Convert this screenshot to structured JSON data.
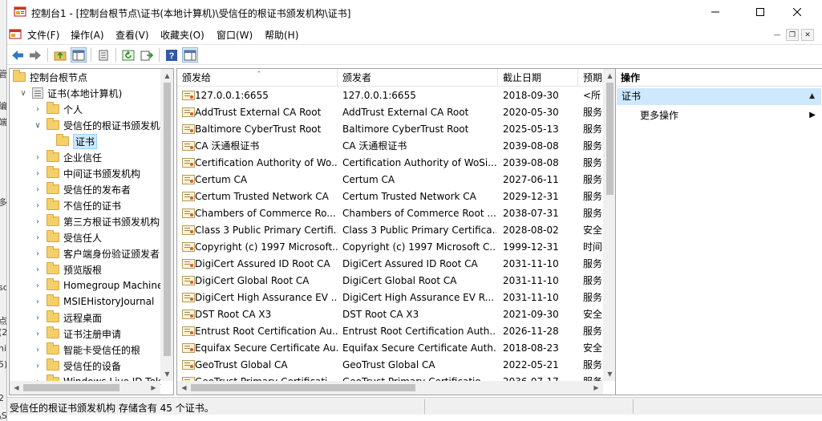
{
  "background_fragments": [
    "管",
    "编",
    "端",
    "多",
    "sc",
    "点",
    "(2",
    "ni",
    "5)",
    "2",
    "\\S"
  ],
  "window": {
    "title": "控制台1 - [控制台根节点\\证书(本地计算机)\\受信任的根证书颁发机构\\证书]"
  },
  "menu": [
    "文件(F)",
    "操作(A)",
    "查看(V)",
    "收藏夹(O)",
    "窗口(W)",
    "帮助(H)"
  ],
  "toolbar_icons": [
    "back-icon",
    "forward-icon",
    "up-folder-icon",
    "show-hide-tree-icon",
    "copy-icon",
    "refresh-icon",
    "export-list-icon",
    "help-icon",
    "show-hide-action-pane-icon"
  ],
  "tree": {
    "root": "控制台根节点",
    "store": "证书(本地计算机)",
    "items": [
      {
        "label": "个人",
        "expanded": false
      },
      {
        "label": "受信任的根证书颁发机构",
        "expanded": true
      },
      {
        "label": "证书",
        "child": true,
        "selected": true
      },
      {
        "label": "企业信任",
        "expanded": false
      },
      {
        "label": "中间证书颁发机构",
        "expanded": false
      },
      {
        "label": "受信任的发布者",
        "expanded": false
      },
      {
        "label": "不信任的证书",
        "expanded": false
      },
      {
        "label": "第三方根证书颁发机构",
        "expanded": false
      },
      {
        "label": "受信任人",
        "expanded": false
      },
      {
        "label": "客户端身份验证颁发者",
        "expanded": false
      },
      {
        "label": "预览版根",
        "expanded": false
      },
      {
        "label": "Homegroup Machine",
        "expanded": false
      },
      {
        "label": "MSIEHistoryJournal",
        "expanded": false
      },
      {
        "label": "远程桌面",
        "expanded": false
      },
      {
        "label": "证书注册申请",
        "expanded": false
      },
      {
        "label": "智能卡受信任的根",
        "expanded": false
      },
      {
        "label": "受信任的设备",
        "expanded": false
      },
      {
        "label": "Windows Live ID Tok",
        "expanded": false
      }
    ]
  },
  "list": {
    "columns": [
      "颁发给",
      "颁发者",
      "截止日期",
      "预期"
    ],
    "rows": [
      [
        "127.0.0.1:6655",
        "127.0.0.1:6655",
        "2018-09-30",
        "<所"
      ],
      [
        "AddTrust External CA Root",
        "AddTrust External CA Root",
        "2020-05-30",
        "服务"
      ],
      [
        "Baltimore CyberTrust Root",
        "Baltimore CyberTrust Root",
        "2025-05-13",
        "服务"
      ],
      [
        "CA 沃通根证书",
        "CA 沃通根证书",
        "2039-08-08",
        "服务"
      ],
      [
        "Certification Authority of Wo...",
        "Certification Authority of WoSi...",
        "2039-08-08",
        "服务"
      ],
      [
        "Certum CA",
        "Certum CA",
        "2027-06-11",
        "服务"
      ],
      [
        "Certum Trusted Network CA",
        "Certum Trusted Network CA",
        "2029-12-31",
        "服务"
      ],
      [
        "Chambers of Commerce Ro...",
        "Chambers of Commerce Root ...",
        "2038-07-31",
        "服务"
      ],
      [
        "Class 3 Public Primary Certifi...",
        "Class 3 Public Primary Certifica...",
        "2028-08-02",
        "安全"
      ],
      [
        "Copyright (c) 1997 Microsoft...",
        "Copyright (c) 1997 Microsoft C...",
        "1999-12-31",
        "时间"
      ],
      [
        "DigiCert Assured ID Root CA",
        "DigiCert Assured ID Root CA",
        "2031-11-10",
        "服务"
      ],
      [
        "DigiCert Global Root CA",
        "DigiCert Global Root CA",
        "2031-11-10",
        "服务"
      ],
      [
        "DigiCert High Assurance EV ...",
        "DigiCert High Assurance EV R...",
        "2031-11-10",
        "服务"
      ],
      [
        "DST Root CA X3",
        "DST Root CA X3",
        "2021-09-30",
        "安全"
      ],
      [
        "Entrust Root Certification Au...",
        "Entrust Root Certification Auth...",
        "2026-11-28",
        "服务"
      ],
      [
        "Equifax Secure Certificate Au...",
        "Equifax Secure Certificate Auth...",
        "2018-08-23",
        "安全"
      ],
      [
        "GeoTrust Global CA",
        "GeoTrust Global CA",
        "2022-05-21",
        "服务"
      ],
      [
        "GeoTrust Primary Certificati...",
        "GeoTrust Primary Certificatio...",
        "2036-07-17",
        "服务"
      ]
    ]
  },
  "actions": {
    "header": "操作",
    "section": "证书",
    "item": "更多操作"
  },
  "status": {
    "text": "受信任的根证书颁发机构 存储含有 45 个证书。"
  }
}
